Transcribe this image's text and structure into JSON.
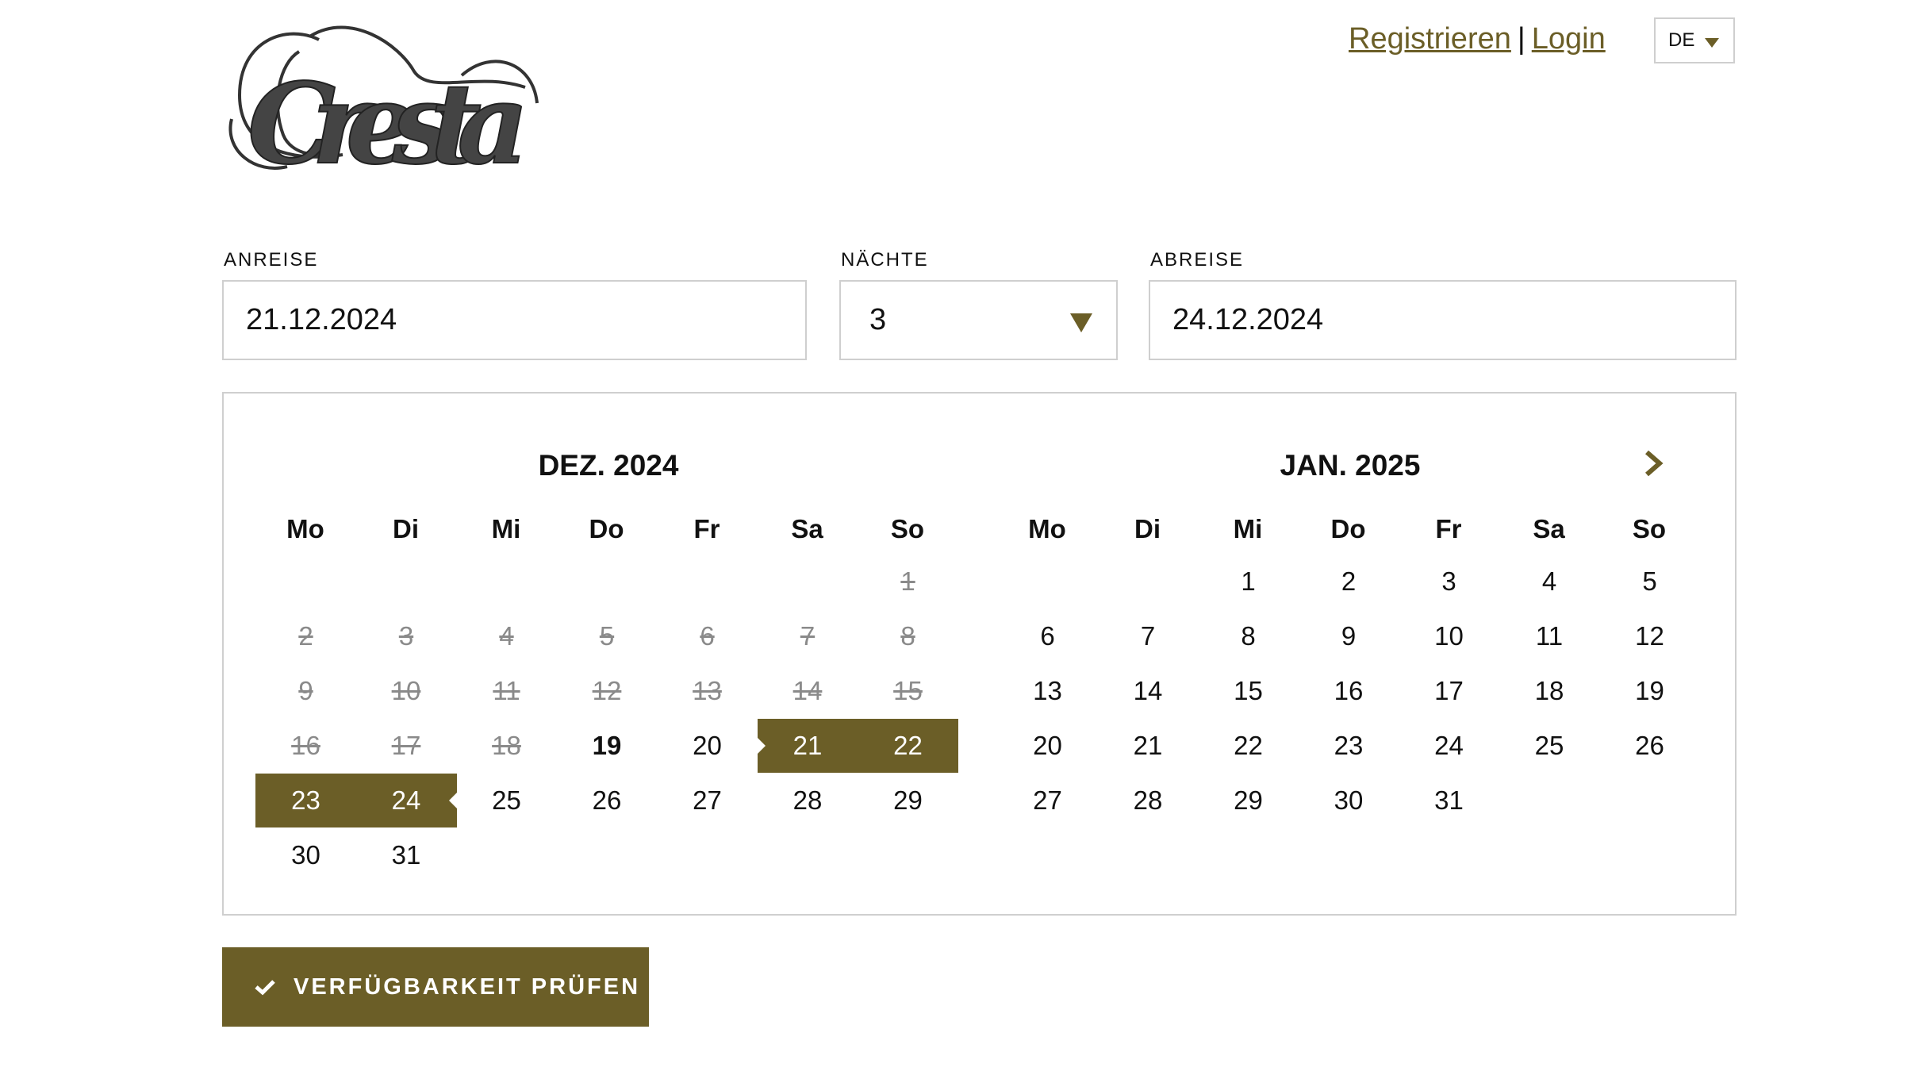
{
  "brand": {
    "logo_text": "Cresta"
  },
  "header": {
    "register_label": "Registrieren",
    "separator": "|",
    "login_label": "Login",
    "language": "DE"
  },
  "form": {
    "arrival_label": "ANREISE",
    "arrival_value": "21.12.2024",
    "nights_label": "NÄCHTE",
    "nights_value": "3",
    "departure_label": "ABREISE",
    "departure_value": "24.12.2024"
  },
  "calendar": {
    "weekdays": [
      "Mo",
      "Di",
      "Mi",
      "Do",
      "Fr",
      "Sa",
      "So"
    ],
    "months": [
      {
        "title": "DEZ. 2024",
        "offset": 6,
        "days": 31,
        "past_until": 18,
        "today": 19,
        "selected": [
          21,
          22,
          23,
          24
        ],
        "range_start": 21,
        "range_end": 24
      },
      {
        "title": "JAN. 2025",
        "offset": 2,
        "days": 31,
        "past_until": 0,
        "today": null,
        "selected": [],
        "range_start": null,
        "range_end": null
      }
    ],
    "next_icon": "chevron-right-icon"
  },
  "cta": {
    "label": "VERFÜGBARKEIT PRÜFEN",
    "icon": "check-icon"
  },
  "colors": {
    "accent": "#6b5e27",
    "border": "#cfcfcf",
    "past": "#8a8a8a"
  }
}
